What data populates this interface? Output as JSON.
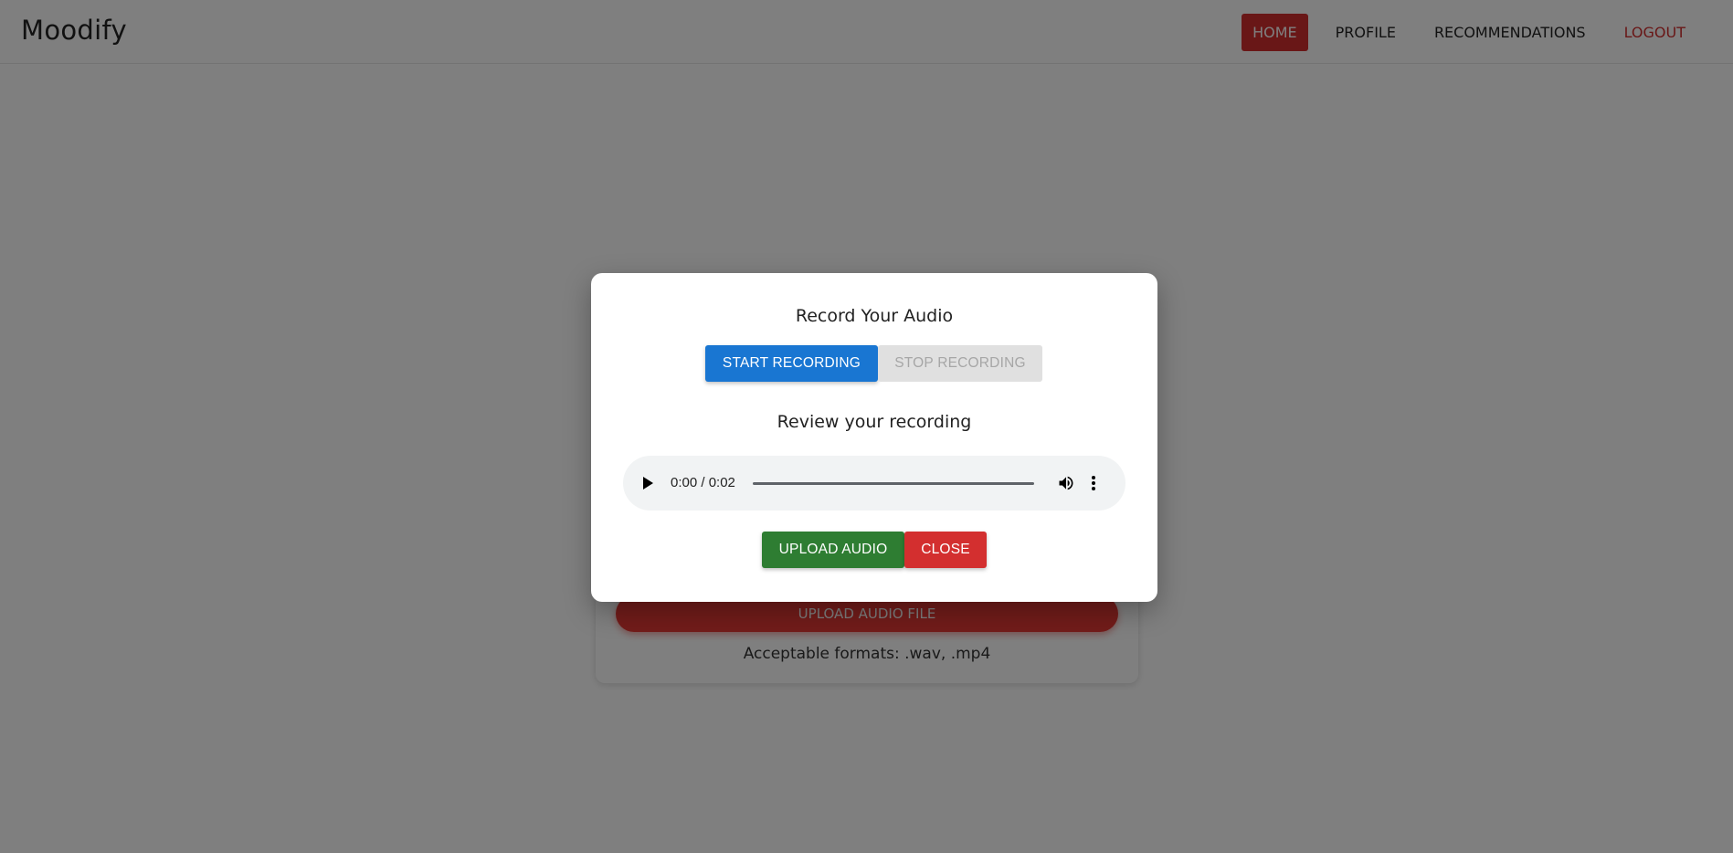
{
  "app": {
    "brand": "Moodify"
  },
  "nav": {
    "items": [
      {
        "label": "HOME",
        "active": true
      },
      {
        "label": "PROFILE",
        "active": false
      },
      {
        "label": "RECOMMENDATIONS",
        "active": false
      },
      {
        "label": "LOGOUT",
        "active": false
      }
    ]
  },
  "background": {
    "upload_file_label": "UPLOAD AUDIO FILE",
    "formats_text": "Acceptable formats: .wav, .mp4"
  },
  "modal": {
    "title": "Record Your Audio",
    "start_label": "START RECORDING",
    "stop_label": "STOP RECORDING",
    "review_title": "Review your recording",
    "player": {
      "time": "0:00 / 0:02",
      "play_icon": "play-icon",
      "volume_icon": "volume-icon",
      "more_icon": "more-options-icon"
    },
    "upload_label": "UPLOAD AUDIO",
    "close_label": "CLOSE"
  },
  "colors": {
    "primary_blue": "#1976d2",
    "success_green": "#2e7d32",
    "danger_red": "#d32f2f",
    "disabled_gray": "#e0e0e0"
  }
}
